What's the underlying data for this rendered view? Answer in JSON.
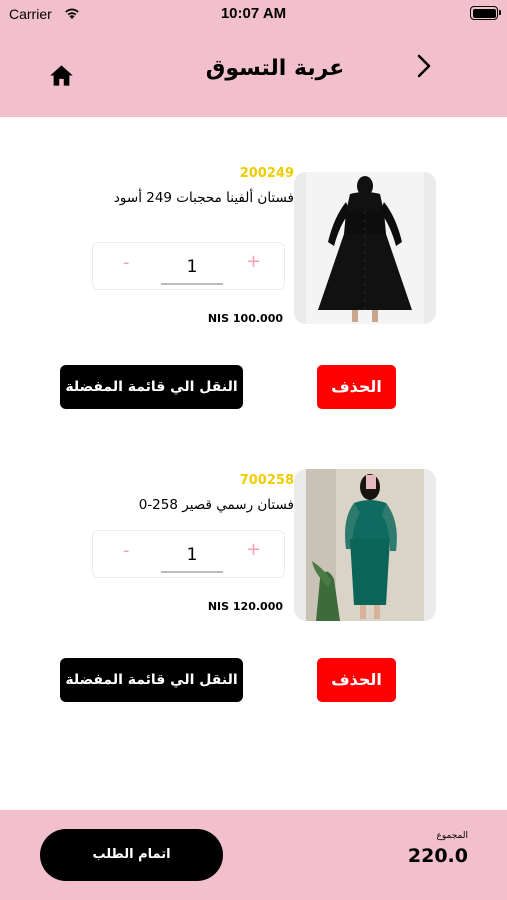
{
  "status_bar": {
    "carrier": "Carrier",
    "time": "10:07 AM"
  },
  "header": {
    "title": "عربة التسوق",
    "home_icon": "home-icon",
    "back_icon": "chevron-right-icon"
  },
  "cart": {
    "items": [
      {
        "code": "200249",
        "name": "فستان ألفينا محجبات 249 أسود",
        "quantity": "1",
        "minus": "-",
        "plus": "+",
        "price": "NIS 100.000",
        "delete_label": "الحذف",
        "move_to_favorites_label": "النقل الي قائمة المفضلة"
      },
      {
        "code": "700258",
        "name": "فستان رسمي قصير 258-0",
        "quantity": "1",
        "minus": "-",
        "plus": "+",
        "price": "NIS 120.000",
        "delete_label": "الحذف",
        "move_to_favorites_label": "النقل الي قائمة المفضلة"
      }
    ]
  },
  "footer": {
    "checkout_label": "اتمام الطلب",
    "total_label": "المجموع",
    "total_value": "220.0"
  },
  "colors": {
    "header_bg": "#f2bfcd",
    "code": "#f0cc00",
    "delete": "#ff0000",
    "stepper_sign": "#f2a0b3"
  }
}
